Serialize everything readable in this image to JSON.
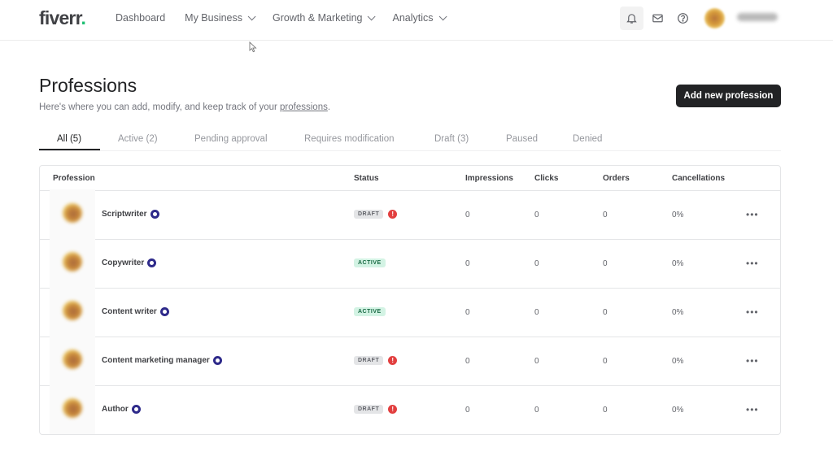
{
  "header": {
    "logo": "fiverr",
    "logo_dot": ".",
    "nav": [
      {
        "label": "Dashboard",
        "dropdown": false
      },
      {
        "label": "My Business",
        "dropdown": true
      },
      {
        "label": "Growth & Marketing",
        "dropdown": true
      },
      {
        "label": "Analytics",
        "dropdown": true
      }
    ],
    "icons": [
      "bell-icon",
      "mail-icon",
      "help-icon"
    ]
  },
  "page": {
    "title": "Professions",
    "subtitle_prefix": "Here's where you can add, modify, and keep track of your ",
    "subtitle_link": "professions",
    "subtitle_suffix": ".",
    "add_button": "Add new profession"
  },
  "tabs": [
    {
      "label": "All (5)",
      "active": true
    },
    {
      "label": "Active (2)",
      "active": false
    },
    {
      "label": "Pending approval",
      "active": false
    },
    {
      "label": "Requires modification",
      "active": false
    },
    {
      "label": "Draft (3)",
      "active": false
    },
    {
      "label": "Paused",
      "active": false
    },
    {
      "label": "Denied",
      "active": false
    }
  ],
  "table": {
    "columns": [
      "Profession",
      "Status",
      "Impressions",
      "Clicks",
      "Orders",
      "Cancellations"
    ],
    "rows": [
      {
        "name": "Scriptwriter",
        "status": "DRAFT",
        "alert": true,
        "impressions": "0",
        "clicks": "0",
        "orders": "0",
        "cancellations": "0%"
      },
      {
        "name": "Copywriter",
        "status": "ACTIVE",
        "alert": false,
        "impressions": "0",
        "clicks": "0",
        "orders": "0",
        "cancellations": "0%"
      },
      {
        "name": "Content writer",
        "status": "ACTIVE",
        "alert": false,
        "impressions": "0",
        "clicks": "0",
        "orders": "0",
        "cancellations": "0%"
      },
      {
        "name": "Content marketing manager",
        "status": "DRAFT",
        "alert": true,
        "impressions": "0",
        "clicks": "0",
        "orders": "0",
        "cancellations": "0%"
      },
      {
        "name": "Author",
        "status": "DRAFT",
        "alert": true,
        "impressions": "0",
        "clicks": "0",
        "orders": "0",
        "cancellations": "0%"
      }
    ],
    "more_label": "•••",
    "alert_glyph": "!"
  },
  "colors": {
    "brand_green": "#1dbf73",
    "primary_dark": "#222325",
    "verified_blue": "#2e2a8a",
    "alert_red": "#e23f3f",
    "active_badge_bg": "#d3f3e4",
    "draft_badge_bg": "#e4e5e7"
  }
}
